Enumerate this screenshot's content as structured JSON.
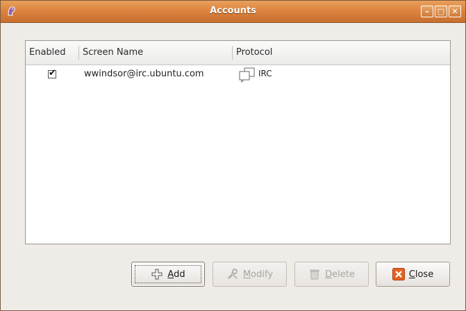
{
  "window": {
    "title": "Accounts",
    "controls": [
      "minimize",
      "maximize",
      "close"
    ]
  },
  "table": {
    "columns": [
      "Enabled",
      "Screen Name",
      "Protocol"
    ],
    "rows": [
      {
        "enabled": true,
        "screen_name": "wwindsor@irc.ubuntu.com",
        "protocol": "IRC"
      }
    ]
  },
  "buttons": {
    "add": {
      "label": "Add",
      "mnemonic": "A",
      "rest": "dd",
      "enabled": true
    },
    "modify": {
      "label": "Modify",
      "mnemonic": "M",
      "rest": "odify",
      "enabled": false
    },
    "delete": {
      "label": "Delete",
      "mnemonic": "D",
      "rest": "elete",
      "enabled": false
    },
    "close": {
      "label": "Close",
      "mnemonic": "C",
      "rest": "lose",
      "enabled": true
    }
  },
  "icons": {
    "app": "pidgin-icon",
    "protocol": "irc-chat-icon",
    "add": "plus-icon",
    "modify": "tools-icon",
    "delete": "trash-icon",
    "close": "close-x-icon"
  },
  "colors": {
    "titlebar": "#dd8440",
    "close_icon_bg": "#e6621f"
  }
}
